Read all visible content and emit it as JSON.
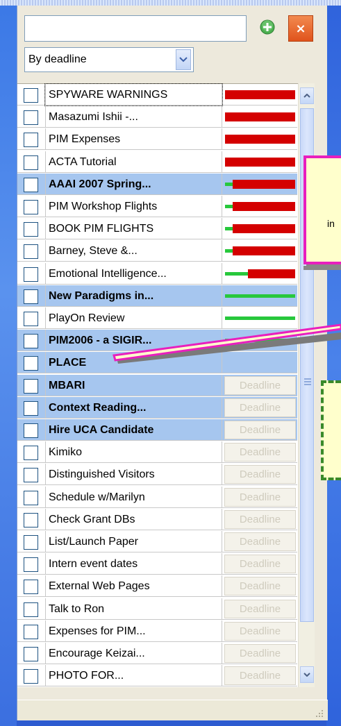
{
  "sort": {
    "value": "By deadline"
  },
  "close_label": "×",
  "deadline_label": "Deadline",
  "callout_text": "in",
  "colors": {
    "bar_red": "#d40000",
    "bar_green": "#27c83c",
    "highlight": "#a6c6ef",
    "callout_border": "#e81fbe"
  },
  "tasks": [
    {
      "title": "SPYWARE WARNINGS",
      "bold": false,
      "bar": "red"
    },
    {
      "title": "Masazumi Ishii -...",
      "bold": false,
      "bar": "red"
    },
    {
      "title": "PIM Expenses",
      "bold": false,
      "bar": "red"
    },
    {
      "title": "ACTA Tutorial",
      "bold": false,
      "bar": "red"
    },
    {
      "title": "AAAI 2007 Spring...",
      "bold": true,
      "bar": "mostly-red"
    },
    {
      "title": "PIM Workshop Flights",
      "bold": false,
      "bar": "mostly-red"
    },
    {
      "title": "BOOK PIM FLIGHTS",
      "bold": false,
      "bar": "mostly-red"
    },
    {
      "title": "Barney, Steve &...",
      "bold": false,
      "bar": "mostly-red"
    },
    {
      "title": "Emotional Intelligence...",
      "bold": false,
      "bar": "half-red"
    },
    {
      "title": "New Paradigms in...",
      "bold": true,
      "bar": "green"
    },
    {
      "title": "PlayOn Review",
      "bold": false,
      "bar": "green"
    },
    {
      "title": "PIM2006 - a SIGIR...",
      "bold": true,
      "bar": "green"
    },
    {
      "title": "PLACE",
      "bold": true,
      "bar": "none"
    },
    {
      "title": "MBARI",
      "bold": true,
      "bar": "deadline"
    },
    {
      "title": "Context Reading...",
      "bold": true,
      "bar": "deadline"
    },
    {
      "title": "Hire UCA Candidate",
      "bold": true,
      "bar": "deadline"
    },
    {
      "title": "Kimiko",
      "bold": false,
      "bar": "deadline"
    },
    {
      "title": "Distinguished Visitors",
      "bold": false,
      "bar": "deadline"
    },
    {
      "title": "Schedule w/Marilyn",
      "bold": false,
      "bar": "deadline"
    },
    {
      "title": "Check Grant DBs",
      "bold": false,
      "bar": "deadline"
    },
    {
      "title": "List/Launch Paper",
      "bold": false,
      "bar": "deadline"
    },
    {
      "title": "Intern event dates",
      "bold": false,
      "bar": "deadline"
    },
    {
      "title": "External Web Pages",
      "bold": false,
      "bar": "deadline"
    },
    {
      "title": "Talk to Ron",
      "bold": false,
      "bar": "deadline"
    },
    {
      "title": "Expenses for PIM...",
      "bold": false,
      "bar": "deadline"
    },
    {
      "title": "Encourage Keizai...",
      "bold": false,
      "bar": "deadline"
    },
    {
      "title": "PHOTO FOR...",
      "bold": false,
      "bar": "deadline"
    }
  ]
}
